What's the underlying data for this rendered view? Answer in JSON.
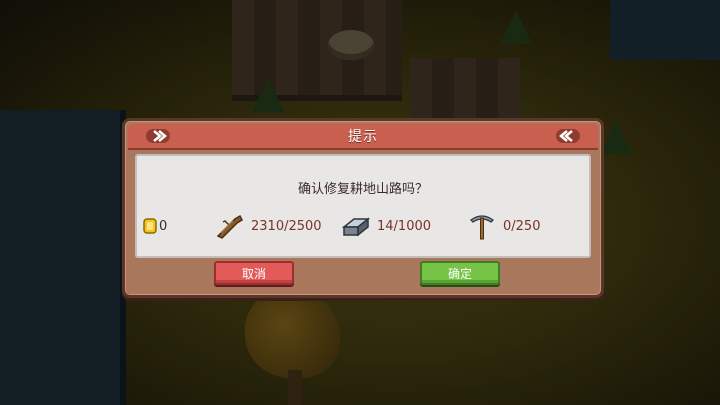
{
  "dialog": {
    "title": "提示",
    "message": "确认修复耕地山路吗？",
    "resources": {
      "gold": {
        "icon": "gold-coin-icon",
        "value": "0"
      },
      "wood": {
        "icon": "wood-log-icon",
        "value": "2310/2500"
      },
      "iron": {
        "icon": "iron-ingot-icon",
        "value": "14/1000"
      },
      "pickaxe": {
        "icon": "pickaxe-icon",
        "value": "0/250"
      }
    },
    "cancel_label": "取消",
    "confirm_label": "确定"
  },
  "colors": {
    "title_bar": "#c95f4f",
    "panel": "#a8775c",
    "content": "#e9e6e6",
    "cancel": "#e35a5a",
    "confirm": "#76c446",
    "value_text": "#7a3226"
  }
}
